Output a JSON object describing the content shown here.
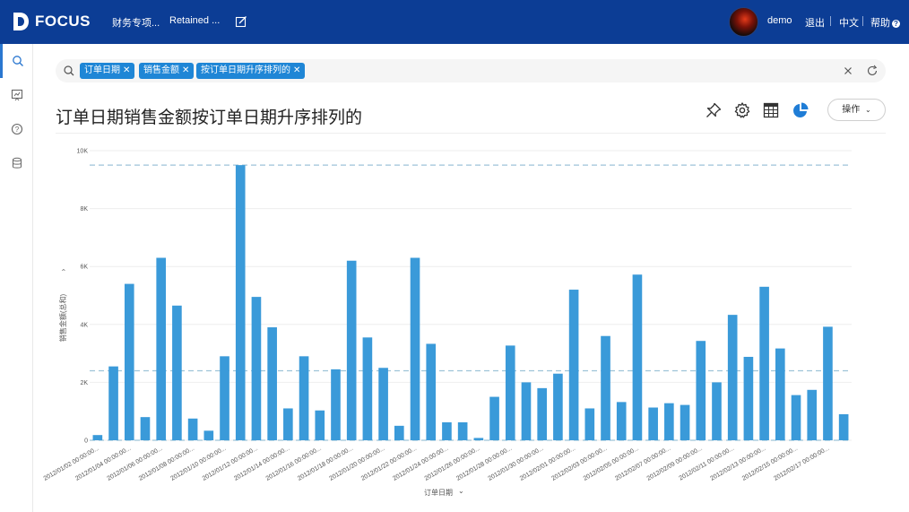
{
  "header": {
    "logo_text": "FOCUS",
    "nav": [
      "财务专项...",
      "Retained ..."
    ],
    "user": "demo",
    "logout": "退出",
    "language": "中文",
    "help": "帮助"
  },
  "search": {
    "chips": [
      "订单日期",
      "销售金额",
      "按订单日期升序排列的"
    ]
  },
  "toolbar": {
    "ops_label": "操作"
  },
  "title": "订单日期销售金额按订单日期升序排列的",
  "colors": {
    "brand": "#0c3d95",
    "bar": "#3a9ad9",
    "chip": "#1f86d6",
    "refline": "#9ec3d8"
  },
  "chart_data": {
    "type": "bar",
    "xlabel": "订单日期",
    "ylabel": "销售金额(总和)",
    "ylim": [
      0,
      10000
    ],
    "y_ticks": [
      "0",
      "2K",
      "4K",
      "6K",
      "8K",
      "10K"
    ],
    "reference_lines": [
      9500,
      2400,
      0
    ],
    "x_tick_labels": [
      "2012/01/02 00:00:00...",
      "2012/01/04 00:00:00...",
      "2012/01/06 00:00:00...",
      "2012/01/08 00:00:00...",
      "2012/01/10 00:00:00...",
      "2012/01/12 00:00:00...",
      "2012/01/14 00:00:00...",
      "2012/01/16 00:00:00...",
      "2012/01/18 00:00:00...",
      "2012/01/20 00:00:00...",
      "2012/01/22 00:00:00...",
      "2012/01/24 00:00:00...",
      "2012/01/26 00:00:00...",
      "2012/01/28 00:00:00...",
      "2012/01/30 00:00:00...",
      "2012/02/01 00:00:00...",
      "2012/02/03 00:00:00...",
      "2012/02/05 00:00:00...",
      "2012/02/07 00:00:00...",
      "2012/02/09 00:00:00...",
      "2012/02/11 00:00:00...",
      "2012/02/13 00:00:00...",
      "2012/02/15 00:00:00...",
      "2012/02/17 00:00:00..."
    ],
    "values": [
      180,
      2550,
      5400,
      800,
      6300,
      4650,
      750,
      330,
      2900,
      9500,
      4950,
      3900,
      1100,
      2900,
      1030,
      2450,
      6200,
      3550,
      2500,
      500,
      6300,
      3330,
      620,
      620,
      80,
      1500,
      3270,
      2000,
      1800,
      2300,
      5200,
      1100,
      3600,
      1320,
      5720,
      1130,
      1280,
      1220,
      3430,
      2000,
      4330,
      2880,
      5300,
      3170,
      1560,
      1740,
      3920,
      900
    ]
  }
}
